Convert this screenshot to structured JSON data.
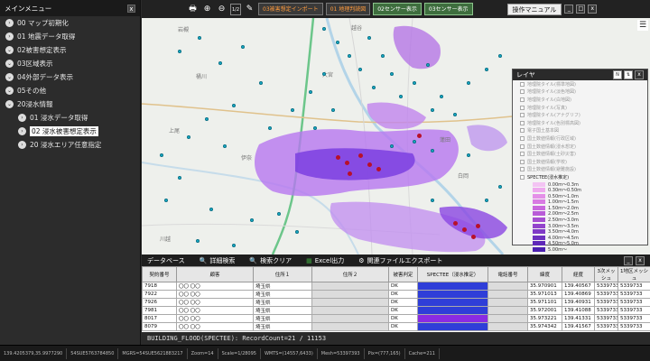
{
  "sidebar": {
    "title": "メインメニュー",
    "close": "x",
    "items": [
      {
        "label": "00 マップ初期化",
        "bullet": "›"
      },
      {
        "label": "01 地震データ取得",
        "bullet": "›"
      },
      {
        "label": "02被害想定表示",
        "bullet": "⌄"
      },
      {
        "label": "03区域表示",
        "bullet": "⌄"
      },
      {
        "label": "04外部データ表示",
        "bullet": "⌄"
      },
      {
        "label": "05その他",
        "bullet": "⌄"
      },
      {
        "label": "20浸水情報",
        "bullet": "⌄"
      }
    ],
    "subitems": [
      {
        "label": "01 浸水データ取得",
        "bullet": "›"
      },
      {
        "label": "02 浸水被害想定表示",
        "bullet": "›"
      },
      {
        "label": "20 浸水エリア任意指定",
        "bullet": "›"
      }
    ]
  },
  "toolbar": {
    "buttons": [
      "03被害想定インポート",
      "01 地理判読図",
      "02センサー表示",
      "03センサー表示"
    ],
    "manual": "操作マニュアル",
    "zoom_value": "1/2"
  },
  "map": {
    "labels": [
      "岩槻",
      "越谷",
      "桶川",
      "上尾",
      "伊奈",
      "蓮田",
      "白岡",
      "川越",
      "大宮"
    ]
  },
  "layers": {
    "title": "レイヤ",
    "items": [
      "地理院タイル(標準地図)",
      "地理院タイル(淡色地図)",
      "地理院タイル(白地図)",
      "地理院タイル(写真)",
      "地理院タイル(アナグリフ)",
      "地理院タイル(色別標高図)",
      "電子国土基本図",
      "国土数値情報(行政区域)",
      "国土数値情報(浸水想定)",
      "国土数値情報(土砂災害)",
      "国土数値情報(学校)",
      "国土数値情報(避難施設)",
      "SPECTEE(浸水推定)"
    ],
    "legend": [
      {
        "label": "0.00m～0.3m",
        "color": "#f3c4f3"
      },
      {
        "label": "0.30m～0.50m",
        "color": "#eeaaee"
      },
      {
        "label": "0.50m～1.0m",
        "color": "#e490e8"
      },
      {
        "label": "1.00m～1.5m",
        "color": "#d87ae2"
      },
      {
        "label": "1.50m～2.0m",
        "color": "#c968dd"
      },
      {
        "label": "2.00m～2.5m",
        "color": "#b95bd8"
      },
      {
        "label": "2.50m～3.0m",
        "color": "#a64ed2"
      },
      {
        "label": "3.00m～3.5m",
        "color": "#9344cc"
      },
      {
        "label": "3.50m～4.0m",
        "color": "#803ac6"
      },
      {
        "label": "4.00m～4.5m",
        "color": "#6e31bf"
      },
      {
        "label": "4.50m～5.0m",
        "color": "#5e28b8"
      },
      {
        "label": "5.00m～",
        "color": "#4b20b0"
      }
    ]
  },
  "datapanel": {
    "tabs": [
      "データベース",
      "詳細検索",
      "検索クリア",
      "Excel出力",
      "関連ファイルエクスポート"
    ],
    "columns": [
      "契約番号",
      "顧客",
      "住所１",
      "住所２",
      "被害判定",
      "SPECTEE（浸水推定）",
      "電話番号",
      "緯度",
      "経度",
      "3次メッシュ",
      "1地区メッシュ"
    ],
    "rows": [
      [
        "7918",
        "〇〇 〇〇",
        "埼玉県",
        "",
        "DK",
        "",
        "",
        "35.970901",
        "139.40567",
        "5339733",
        "5339733"
      ],
      [
        "7922",
        "〇〇 〇〇",
        "埼玉県",
        "",
        "DK",
        "",
        "",
        "35.971013",
        "139.40869",
        "5339733",
        "5339733"
      ],
      [
        "7926",
        "〇〇 〇〇",
        "埼玉県",
        "",
        "DK",
        "",
        "",
        "35.971101",
        "139.40931",
        "5339733",
        "5339733"
      ],
      [
        "7981",
        "〇〇 〇〇",
        "埼玉県",
        "",
        "DK",
        "",
        "",
        "35.972001",
        "139.41088",
        "5339733",
        "5339733"
      ],
      [
        "8017",
        "〇〇 〇〇",
        "埼玉県",
        "",
        "DK",
        "",
        "",
        "35.973221",
        "139.41331",
        "5339733",
        "5339733"
      ],
      [
        "8079",
        "〇〇 〇〇",
        "埼玉県",
        "",
        "DK",
        "",
        "",
        "35.974342",
        "139.41567",
        "5339733",
        "5339733"
      ]
    ],
    "row_colors": [
      "blue",
      "blue",
      "blue",
      "blue",
      "purple",
      "blue"
    ],
    "status": "BUILDING_FLOOD(SPECTEE): RecordCount=21 / 11153"
  },
  "footer": [
    "139.4205379,35.9977290",
    "54SUE5763784850",
    "MGRS=54SUE5621883217",
    "Zoom=14",
    "Scale=1/28095",
    "WMTS=(14557,6433)",
    "Mesh=53397393",
    "Pix=(777,165)",
    "Cache=211"
  ]
}
